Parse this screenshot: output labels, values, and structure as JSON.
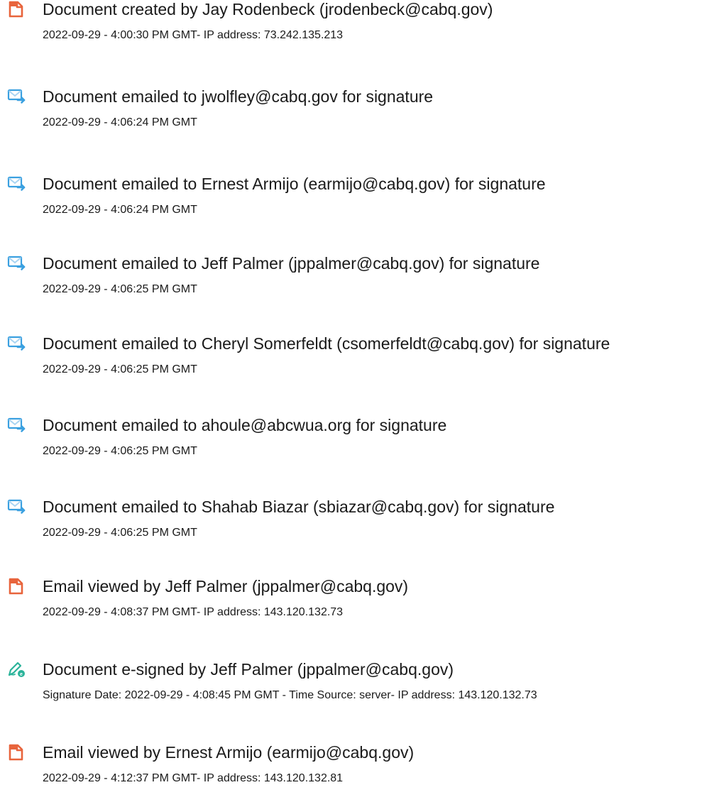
{
  "events": [
    {
      "icon": "document-created-icon",
      "title": "Document created by Jay Rodenbeck (jrodenbeck@cabq.gov)",
      "detail": "2022-09-29 - 4:00:30 PM GMT- IP address: 73.242.135.213"
    },
    {
      "icon": "email-sent-icon",
      "title": "Document emailed to jwolfley@cabq.gov for signature",
      "detail": "2022-09-29 - 4:06:24 PM GMT"
    },
    {
      "icon": "email-sent-icon",
      "title": "Document emailed to Ernest Armijo (earmijo@cabq.gov) for signature",
      "detail": "2022-09-29 - 4:06:24 PM GMT"
    },
    {
      "icon": "email-sent-icon",
      "title": "Document emailed to Jeff Palmer (jppalmer@cabq.gov) for signature",
      "detail": "2022-09-29 - 4:06:25 PM GMT"
    },
    {
      "icon": "email-sent-icon",
      "title": "Document emailed to Cheryl Somerfeldt (csomerfeldt@cabq.gov) for signature",
      "detail": "2022-09-29 - 4:06:25 PM GMT"
    },
    {
      "icon": "email-sent-icon",
      "title": "Document emailed to ahoule@abcwua.org for signature",
      "detail": "2022-09-29 - 4:06:25 PM GMT"
    },
    {
      "icon": "email-sent-icon",
      "title": "Document emailed to Shahab Biazar (sbiazar@cabq.gov) for signature",
      "detail": "2022-09-29 - 4:06:25 PM GMT"
    },
    {
      "icon": "email-viewed-icon",
      "title": "Email viewed by Jeff Palmer (jppalmer@cabq.gov)",
      "detail": "2022-09-29 - 4:08:37 PM GMT- IP address: 143.120.132.73"
    },
    {
      "icon": "e-signed-icon",
      "title": "Document e-signed by Jeff Palmer (jppalmer@cabq.gov)",
      "detail": "Signature Date: 2022-09-29 - 4:08:45 PM GMT - Time Source: server- IP address: 143.120.132.73"
    },
    {
      "icon": "email-viewed-icon",
      "title": "Email viewed by Ernest Armijo (earmijo@cabq.gov)",
      "detail": "2022-09-29 - 4:12:37 PM GMT- IP address: 143.120.132.81"
    }
  ],
  "colors": {
    "text": "#1a1a1a",
    "document_icon": "#e8643c",
    "email_icon_blue": "#3aa0e0",
    "email_icon_light": "#a9d4f2",
    "signature_icon_green": "#2bb39a"
  }
}
